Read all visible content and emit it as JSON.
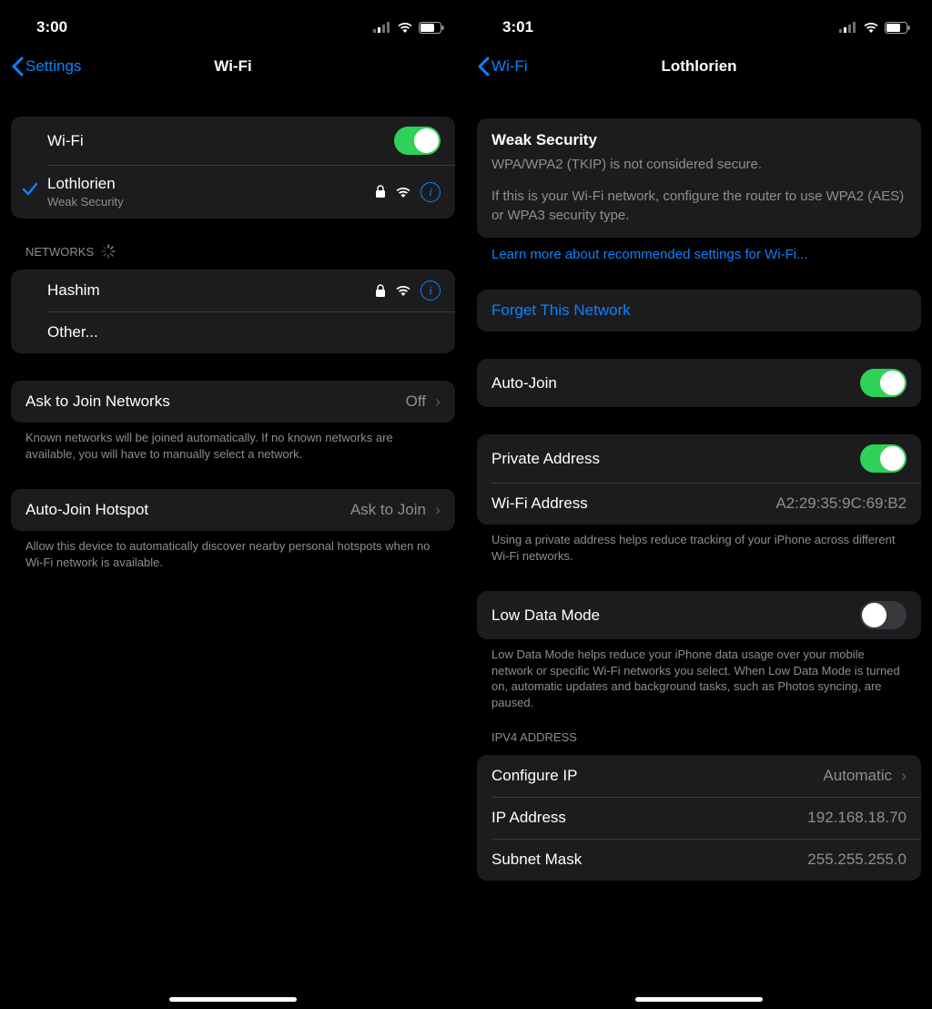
{
  "left": {
    "time": "3:00",
    "back_label": "Settings",
    "title": "Wi-Fi",
    "wifi_row_label": "Wi-Fi",
    "connected_name": "Lothlorien",
    "connected_sub": "Weak Security",
    "networks_header": "NETWORKS",
    "network_1": "Hashim",
    "other_label": "Other...",
    "ask_join_label": "Ask to Join Networks",
    "ask_join_value": "Off",
    "ask_join_footer": "Known networks will be joined automatically. If no known networks are available, you will have to manually select a network.",
    "auto_hotspot_label": "Auto-Join Hotspot",
    "auto_hotspot_value": "Ask to Join",
    "auto_hotspot_footer": "Allow this device to automatically discover nearby personal hotspots when no Wi-Fi network is available."
  },
  "right": {
    "time": "3:01",
    "back_label": "Wi-Fi",
    "title": "Lothlorien",
    "notice_title": "Weak Security",
    "notice_line1": "WPA/WPA2 (TKIP) is not considered secure.",
    "notice_line2": "If this is your Wi-Fi network, configure the router to use WPA2 (AES) or WPA3 security type.",
    "learn_more": "Learn more about recommended settings for Wi-Fi...",
    "forget_label": "Forget This Network",
    "auto_join_label": "Auto-Join",
    "private_addr_label": "Private Address",
    "wifi_addr_label": "Wi-Fi Address",
    "wifi_addr_value": "A2:29:35:9C:69:B2",
    "private_footer": "Using a private address helps reduce tracking of your iPhone across different Wi-Fi networks.",
    "low_data_label": "Low Data Mode",
    "low_data_footer": "Low Data Mode helps reduce your iPhone data usage over your mobile network or specific Wi-Fi networks you select. When Low Data Mode is turned on, automatic updates and background tasks, such as Photos syncing, are paused.",
    "ipv4_header": "IPV4 ADDRESS",
    "configure_ip_label": "Configure IP",
    "configure_ip_value": "Automatic",
    "ip_label": "IP Address",
    "ip_value": "192.168.18.70",
    "subnet_label": "Subnet Mask",
    "subnet_value": "255.255.255.0"
  }
}
